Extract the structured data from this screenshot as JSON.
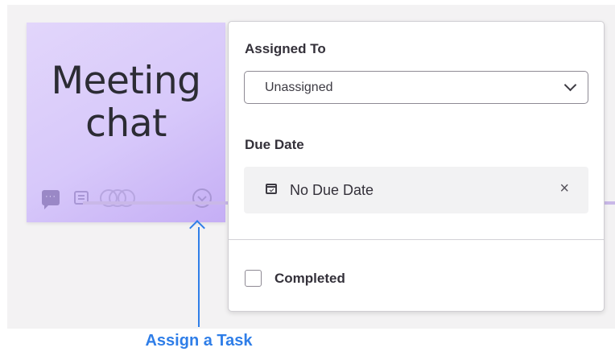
{
  "sticky_note": {
    "title": "Meeting\nchat",
    "color": "#d8c9fa",
    "toolbar": [
      "comment-icon",
      "document-icon",
      "avatars-icon",
      "task-icon"
    ],
    "comment_glyph": "···"
  },
  "task_panel": {
    "assigned_to": {
      "label": "Assigned To",
      "value": "Unassigned"
    },
    "due_date": {
      "label": "Due Date",
      "value": "No Due Date",
      "clear_glyph": "×"
    },
    "completed": {
      "label": "Completed",
      "checked": false
    }
  },
  "annotation": {
    "text": "Assign a Task",
    "color": "#2f7ee8"
  }
}
